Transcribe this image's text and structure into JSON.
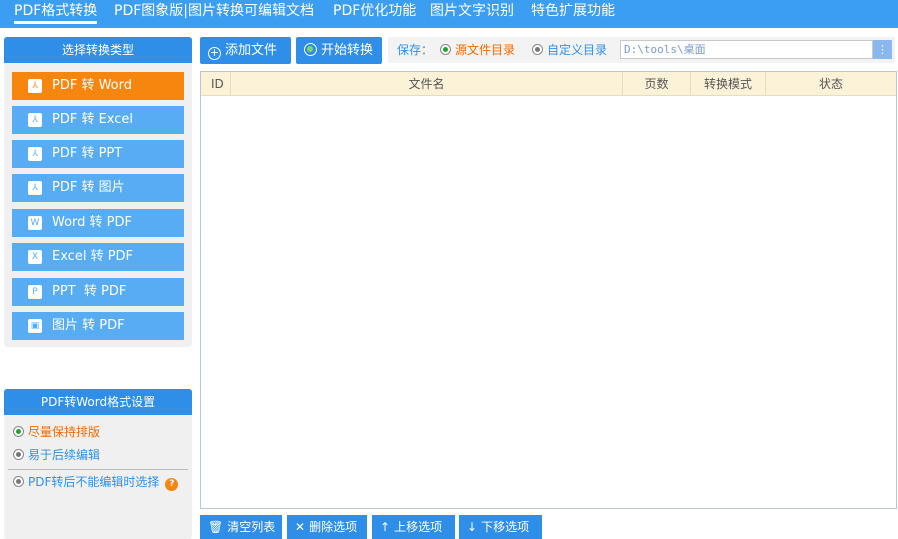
{
  "top_tabs": [
    {
      "label": "PDF格式转换"
    },
    {
      "label": "PDF图象版|图片转换可编辑文档"
    },
    {
      "label": "PDF优化功能"
    },
    {
      "label": "图片文字识别"
    },
    {
      "label": "特色扩展功能"
    }
  ],
  "type_panel": {
    "title": "选择转换类型",
    "items": [
      {
        "label": "PDF 转 Word",
        "icon": "pdf-icon",
        "glyph": "⅄"
      },
      {
        "label": "PDF 转 Excel",
        "icon": "pdf-icon",
        "glyph": "⅄"
      },
      {
        "label": "PDF 转 PPT",
        "icon": "pdf-icon",
        "glyph": "⅄"
      },
      {
        "label": "PDF 转 图片",
        "icon": "pdf-icon",
        "glyph": "⅄"
      },
      {
        "label": "Word 转 PDF",
        "icon": "word-icon",
        "glyph": "W"
      },
      {
        "label": "Excel 转 PDF",
        "icon": "excel-icon",
        "glyph": "X"
      },
      {
        "label": "PPT  转 PDF",
        "icon": "ppt-icon",
        "glyph": "P"
      },
      {
        "label": "图片 转 PDF",
        "icon": "image-icon",
        "glyph": "▣"
      }
    ]
  },
  "settings_panel": {
    "title": "PDF转Word格式设置",
    "options": [
      {
        "label": "尽量保持排版"
      },
      {
        "label": "易于后续编辑"
      },
      {
        "label": "PDF转后不能编辑时选择"
      }
    ],
    "help": "?"
  },
  "toolbar": {
    "add_file": "添加文件",
    "add_glyph": "+",
    "start_convert": "开始转换",
    "save_label": "保存：",
    "save_source": "源文件目录",
    "save_custom": "自定义目录",
    "path_value": "D:\\tools\\桌面",
    "path_button_glyph": "⋮"
  },
  "table": {
    "columns": [
      "ID",
      "文件名",
      "页数",
      "转换模式",
      "状态"
    ]
  },
  "bottom_buttons": [
    {
      "label": "清空列表",
      "glyph": "🗑",
      "icon": "trash-icon"
    },
    {
      "label": "删除选项",
      "glyph": "✕",
      "icon": "close-icon"
    },
    {
      "label": "上移选项",
      "glyph": "↑",
      "icon": "arrow-up-icon"
    },
    {
      "label": "下移选项",
      "glyph": "↓",
      "icon": "arrow-down-icon"
    }
  ],
  "colors": {
    "accent_blue": "#2f8fe8",
    "active_orange": "#f7860f",
    "selected_text": "#f26a00"
  }
}
